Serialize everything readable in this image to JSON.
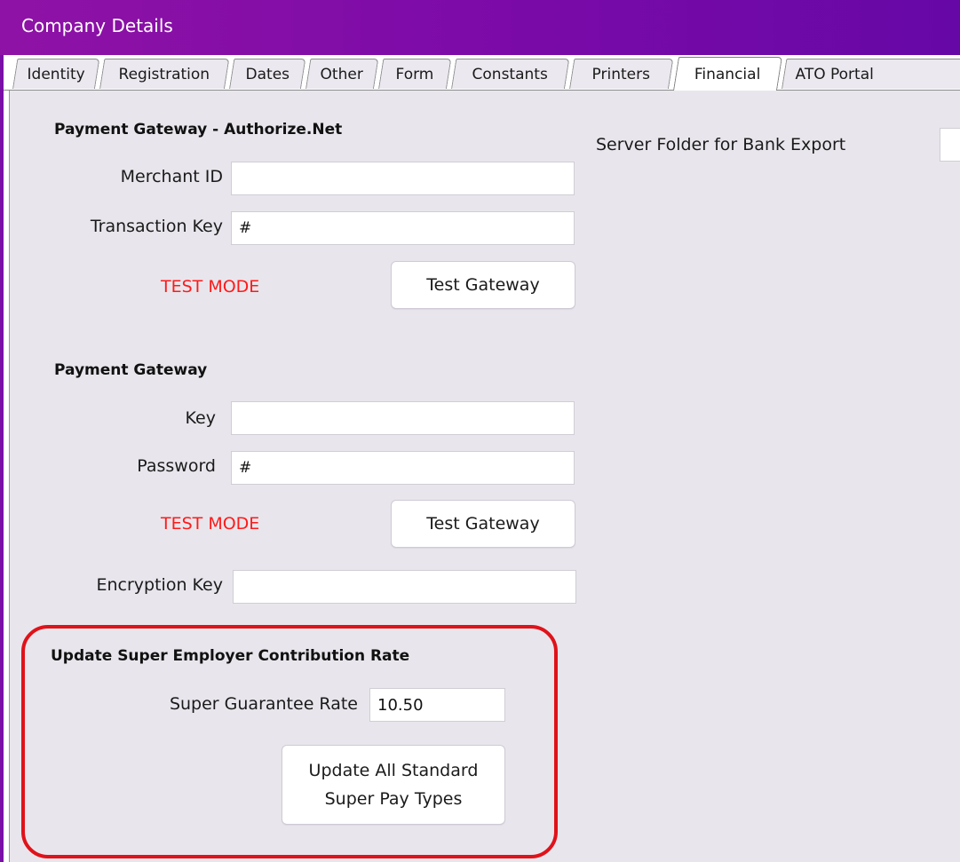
{
  "window": {
    "title": "Company Details"
  },
  "tabs": [
    {
      "label": "Identity",
      "active": false
    },
    {
      "label": "Registration",
      "active": false
    },
    {
      "label": "Dates",
      "active": false
    },
    {
      "label": "Other",
      "active": false
    },
    {
      "label": "Form",
      "active": false
    },
    {
      "label": "Constants",
      "active": false
    },
    {
      "label": "Printers",
      "active": false
    },
    {
      "label": "Financial",
      "active": true
    },
    {
      "label": "ATO Portal",
      "active": false
    }
  ],
  "authorize_net": {
    "title": "Payment Gateway - Authorize.Net",
    "merchant_id_label": "Merchant ID",
    "merchant_id_value": "",
    "transaction_key_label": "Transaction Key",
    "transaction_key_value": "#",
    "test_mode_label": "TEST MODE",
    "test_button_label": "Test Gateway"
  },
  "payment_gateway": {
    "title": "Payment Gateway",
    "key_label": "Key",
    "key_value": "",
    "password_label": "Password",
    "password_value": "#",
    "test_mode_label": "TEST MODE",
    "test_button_label": "Test Gateway",
    "encryption_key_label": "Encryption Key",
    "encryption_key_value": ""
  },
  "super_rate": {
    "title": "Update Super Employer Contribution Rate",
    "rate_label": "Super Guarantee Rate",
    "rate_value": "10.50",
    "update_button_line1": "Update All Standard",
    "update_button_line2": "Super Pay Types"
  },
  "bank_export": {
    "label": "Server Folder for Bank Export",
    "value": ""
  },
  "colors": {
    "title_bar": "#8f12a6",
    "test_mode": "#ff1a1a",
    "highlight": "#e0121a",
    "panel_background": "#e8e6ec"
  }
}
